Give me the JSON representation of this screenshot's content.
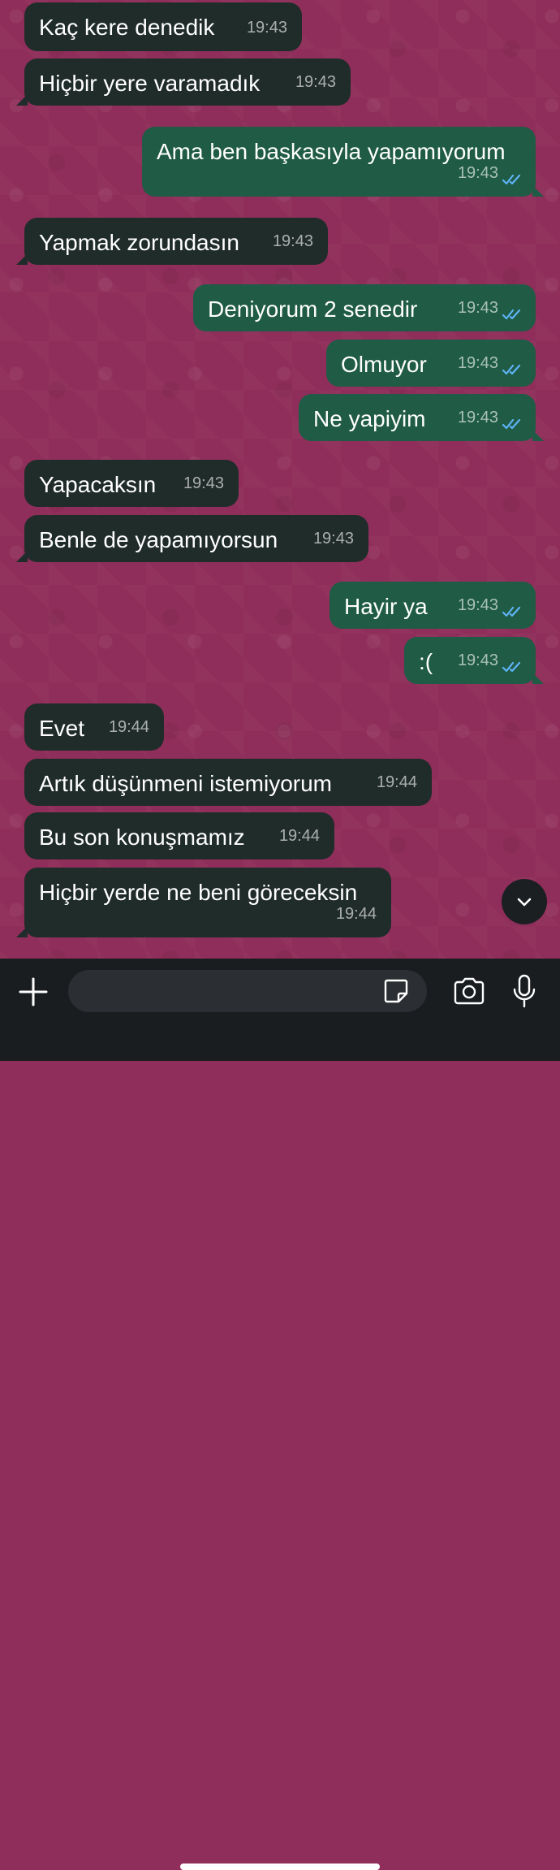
{
  "colors": {
    "background": "#8f2e5a",
    "incoming_bubble": "#202c2a",
    "outgoing_bubble": "#1f5b45",
    "read_ticks": "#5fb3f5",
    "input_bar": "#1a1d20"
  },
  "messages": [
    {
      "direction": "in",
      "text": "Kaç kere denedik",
      "time": "19:43"
    },
    {
      "direction": "in",
      "text": "Hiçbir yere varamadık",
      "time": "19:43"
    },
    {
      "direction": "out",
      "text": "Ama ben başkasıyla yapamıyorum",
      "time": "19:43",
      "status": "read"
    },
    {
      "direction": "in",
      "text": "Yapmak zorundasın",
      "time": "19:43"
    },
    {
      "direction": "out",
      "text": "Deniyorum 2 senedir",
      "time": "19:43",
      "status": "read"
    },
    {
      "direction": "out",
      "text": "Olmuyor",
      "time": "19:43",
      "status": "read"
    },
    {
      "direction": "out",
      "text": "Ne yapiyim",
      "time": "19:43",
      "status": "read"
    },
    {
      "direction": "in",
      "text": "Yapacaksın",
      "time": "19:43"
    },
    {
      "direction": "in",
      "text": "Benle de yapamıyorsun",
      "time": "19:43"
    },
    {
      "direction": "out",
      "text": "Hayir ya",
      "time": "19:43",
      "status": "read"
    },
    {
      "direction": "out",
      "text": ":(",
      "time": "19:43",
      "status": "read"
    },
    {
      "direction": "in",
      "text": "Evet",
      "time": "19:44"
    },
    {
      "direction": "in",
      "text": "Artık düşünmeni istemiyorum",
      "time": "19:44"
    },
    {
      "direction": "in",
      "text": "Bu son konuşmamız",
      "time": "19:44"
    },
    {
      "direction": "in",
      "text": "Hiçbir yerde ne beni göreceksin",
      "time": "19:44"
    }
  ],
  "composer": {
    "input_value": "",
    "icons": {
      "attach": "plus-icon",
      "sticker": "sticker-icon",
      "camera": "camera-icon",
      "voice": "microphone-icon",
      "scroll_down": "chevron-down-icon"
    }
  }
}
